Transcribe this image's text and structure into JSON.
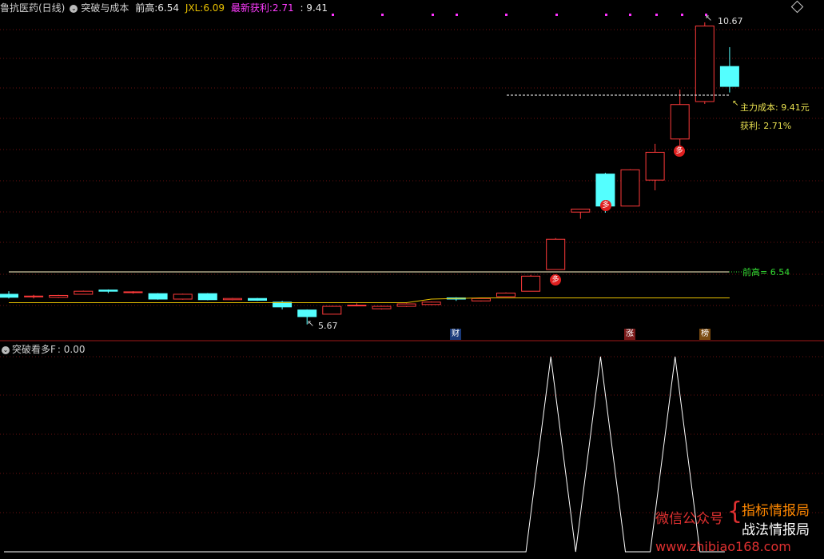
{
  "header": {
    "stock_name": "鲁抗医药(日线)",
    "indicator": "突破与成本",
    "prev_high_label": "前高:",
    "prev_high_value": "6.54",
    "jxl_label": "JXL:",
    "jxl_value": "6.09",
    "profit_label": "最新获利:",
    "profit_value": "2.71",
    "cost_value": ": 9.41"
  },
  "main_chart": {
    "high_label": "10.67",
    "low_label": "5.67",
    "cost_label": "主力成本: 9.41元",
    "profit_annot": "获利: 2.71%",
    "prev_high_annot": "前高= 6.54",
    "duo_marker": "多",
    "bottom_tags": [
      "财",
      "涨",
      "榜"
    ],
    "colors": {
      "up": "#ff3a3a",
      "down": "#54ffff",
      "grid": "#6a1010",
      "ma": "#e8c000"
    },
    "candles": [
      {
        "o": 6.17,
        "c": 6.12,
        "h": 6.22,
        "l": 6.1
      },
      {
        "o": 6.13,
        "c": 6.14,
        "h": 6.16,
        "l": 6.1
      },
      {
        "o": 6.12,
        "c": 6.15,
        "h": 6.16,
        "l": 6.11
      },
      {
        "o": 6.17,
        "c": 6.22,
        "h": 6.23,
        "l": 6.17
      },
      {
        "o": 6.24,
        "c": 6.22,
        "h": 6.25,
        "l": 6.19
      },
      {
        "o": 6.2,
        "c": 6.21,
        "h": 6.22,
        "l": 6.18
      },
      {
        "o": 6.18,
        "c": 6.09,
        "h": 6.19,
        "l": 6.08
      },
      {
        "o": 6.09,
        "c": 6.17,
        "h": 6.18,
        "l": 6.08
      },
      {
        "o": 6.18,
        "c": 6.08,
        "h": 6.19,
        "l": 6.07
      },
      {
        "o": 6.08,
        "c": 6.1,
        "h": 6.11,
        "l": 6.07
      },
      {
        "o": 6.1,
        "c": 6.07,
        "h": 6.11,
        "l": 6.06
      },
      {
        "o": 6.04,
        "c": 5.96,
        "h": 6.06,
        "l": 5.92
      },
      {
        "o": 5.91,
        "c": 5.8,
        "h": 5.92,
        "l": 5.67
      },
      {
        "o": 5.84,
        "c": 5.97,
        "h": 5.98,
        "l": 5.84
      },
      {
        "o": 5.99,
        "c": 5.99,
        "h": 6.02,
        "l": 5.97
      },
      {
        "o": 5.93,
        "c": 5.97,
        "h": 5.98,
        "l": 5.92
      },
      {
        "o": 5.97,
        "c": 6.01,
        "h": 6.02,
        "l": 5.96
      },
      {
        "o": 6.0,
        "c": 6.04,
        "h": 6.05,
        "l": 5.99
      },
      {
        "o": 6.11,
        "c": 6.09,
        "h": 6.12,
        "l": 6.06
      },
      {
        "o": 6.06,
        "c": 6.1,
        "h": 6.11,
        "l": 6.05
      },
      {
        "o": 6.13,
        "c": 6.19,
        "h": 6.2,
        "l": 6.13
      },
      {
        "o": 6.22,
        "c": 6.47,
        "h": 6.49,
        "l": 6.22
      },
      {
        "o": 6.58,
        "c": 7.08,
        "h": 7.1,
        "l": 6.58
      },
      {
        "o": 7.53,
        "c": 7.58,
        "h": 7.58,
        "l": 7.42
      },
      {
        "o": 8.16,
        "c": 7.63,
        "h": 8.18,
        "l": 7.52
      },
      {
        "o": 7.63,
        "c": 8.23,
        "h": 8.24,
        "l": 7.63
      },
      {
        "o": 8.06,
        "c": 8.52,
        "h": 8.66,
        "l": 7.89
      },
      {
        "o": 8.74,
        "c": 9.31,
        "h": 9.56,
        "l": 8.58
      },
      {
        "o": 9.36,
        "c": 10.61,
        "h": 10.67,
        "l": 9.32
      },
      {
        "o": 9.94,
        "c": 9.61,
        "h": 10.26,
        "l": 9.51
      }
    ],
    "ma_line": [
      6.03,
      6.03,
      6.03,
      6.03,
      6.03,
      6.03,
      6.03,
      6.03,
      6.03,
      6.03,
      6.03,
      6.03,
      6.03,
      6.03,
      6.03,
      6.03,
      6.03,
      6.09,
      6.1,
      6.11,
      6.11,
      6.11,
      6.11,
      6.11,
      6.11,
      6.11,
      6.11,
      6.11,
      6.11,
      6.11
    ]
  },
  "sub_panel": {
    "title": "突破看多F",
    "value": ": 0.00"
  },
  "watermark": {
    "left": "微信公众号",
    "right_top": "指标情报局",
    "right_bottom": "战法情报局",
    "url": "www.zhibiao168.com"
  }
}
